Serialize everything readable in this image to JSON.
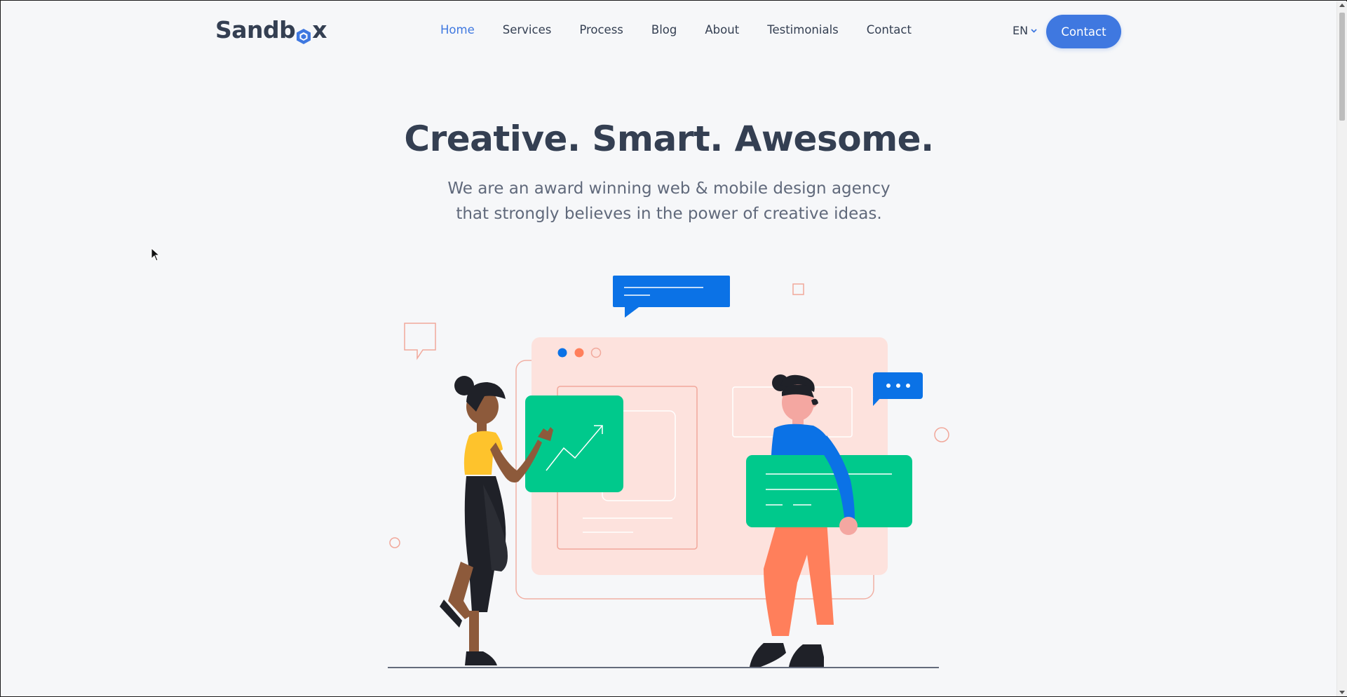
{
  "brand": {
    "logo_text_start": "Sandb",
    "logo_text_end": "x"
  },
  "nav": {
    "items": [
      {
        "label": "Home",
        "active": true
      },
      {
        "label": "Services"
      },
      {
        "label": "Process"
      },
      {
        "label": "Blog"
      },
      {
        "label": "About"
      },
      {
        "label": "Testimonials"
      },
      {
        "label": "Contact"
      }
    ],
    "language": "EN",
    "cta_label": "Contact"
  },
  "hero": {
    "title": "Creative. Smart. Awesome.",
    "subtitle_line1": "We are an award winning web & mobile design agency",
    "subtitle_line2": "that strongly believes in the power of creative ideas."
  },
  "colors": {
    "primary": "#3f78e0",
    "heading": "#343f52",
    "body_text": "#60697b",
    "background": "#f6f7f9",
    "illustration_blue": "#0b72e6",
    "illustration_green": "#00c98c",
    "illustration_orange": "#ff7f5b",
    "illustration_pink": "#fde2dd",
    "illustration_yellow": "#fec32c"
  },
  "icons": {
    "language_caret": "chevron-down-icon",
    "logo_mark": "hexagon-logo-icon",
    "chart": "trend-up-arrow-icon",
    "chat": "speech-bubble-icon",
    "cursor": "mouse-pointer-icon"
  }
}
